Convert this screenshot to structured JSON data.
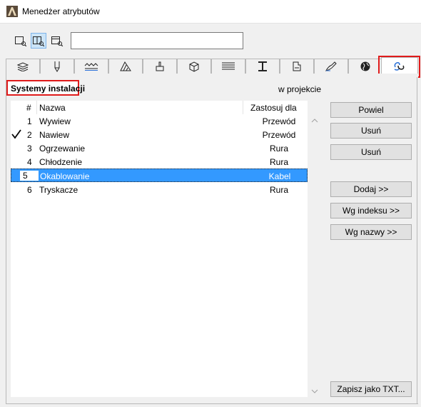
{
  "window": {
    "title": "Menedżer atrybutów"
  },
  "toolbar": {
    "search_value": ""
  },
  "tabs": [
    {
      "icon": "layers-icon"
    },
    {
      "icon": "pen-icon"
    },
    {
      "icon": "line-type-icon"
    },
    {
      "icon": "fill-icon"
    },
    {
      "icon": "paint-brush-icon"
    },
    {
      "icon": "composite-icon"
    },
    {
      "icon": "profile-icon"
    },
    {
      "icon": "i-beam-icon"
    },
    {
      "icon": "zone-icon"
    },
    {
      "icon": "surface-icon"
    },
    {
      "icon": "globe-icon"
    },
    {
      "icon": "mep-system-icon"
    }
  ],
  "panel": {
    "title": "Systemy instalacji",
    "subtitle": "w projekcie",
    "columns": {
      "num": "#",
      "name": "Nazwa",
      "applies": "Zastosuj dla"
    }
  },
  "rows": [
    {
      "num": "1",
      "name": "Wywiew",
      "applies": "Przewód",
      "checked": false,
      "selected": false
    },
    {
      "num": "2",
      "name": "Nawiew",
      "applies": "Przewód",
      "checked": true,
      "selected": false
    },
    {
      "num": "3",
      "name": "Ogrzewanie",
      "applies": "Rura",
      "checked": false,
      "selected": false
    },
    {
      "num": "4",
      "name": "Chłodzenie",
      "applies": "Rura",
      "checked": false,
      "selected": false
    },
    {
      "num": "5",
      "name": "Okablowanie",
      "applies": "Kabel",
      "checked": false,
      "selected": true
    },
    {
      "num": "6",
      "name": "Tryskacze",
      "applies": "Rura",
      "checked": false,
      "selected": false
    }
  ],
  "buttons": {
    "duplicate": "Powiel",
    "delete": "Usuń",
    "delete2": "Usuń",
    "add": "Dodaj >>",
    "by_index": "Wg indeksu >>",
    "by_name": "Wg nazwy >>",
    "save_txt": "Zapisz jako TXT..."
  },
  "colors": {
    "selection": "#3399ff",
    "highlight": "#e01b1b",
    "active_view": "#cce4f7"
  }
}
